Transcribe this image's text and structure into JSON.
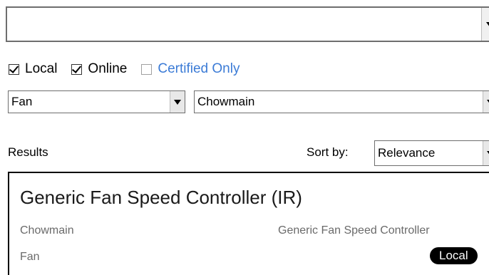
{
  "search": {
    "value": ""
  },
  "filters": {
    "local": {
      "label": "Local",
      "checked": true
    },
    "online": {
      "label": "Online",
      "checked": true
    },
    "certified": {
      "label": "Certified Only",
      "checked": false,
      "color": "#3b7bd6"
    },
    "device_type": "Fan",
    "manufacturer": "Chowmain"
  },
  "results": {
    "label": "Results",
    "sort_label": "Sort by:",
    "sort_value": "Relevance",
    "items": [
      {
        "title": "Generic Fan Speed Controller (IR)",
        "manufacturer": "Chowmain",
        "model": "Generic Fan Speed Controller",
        "category": "Fan",
        "badge": "Local"
      }
    ]
  },
  "icons": {
    "dropdown": "chevron-down-icon",
    "check": "checkmark-icon"
  }
}
